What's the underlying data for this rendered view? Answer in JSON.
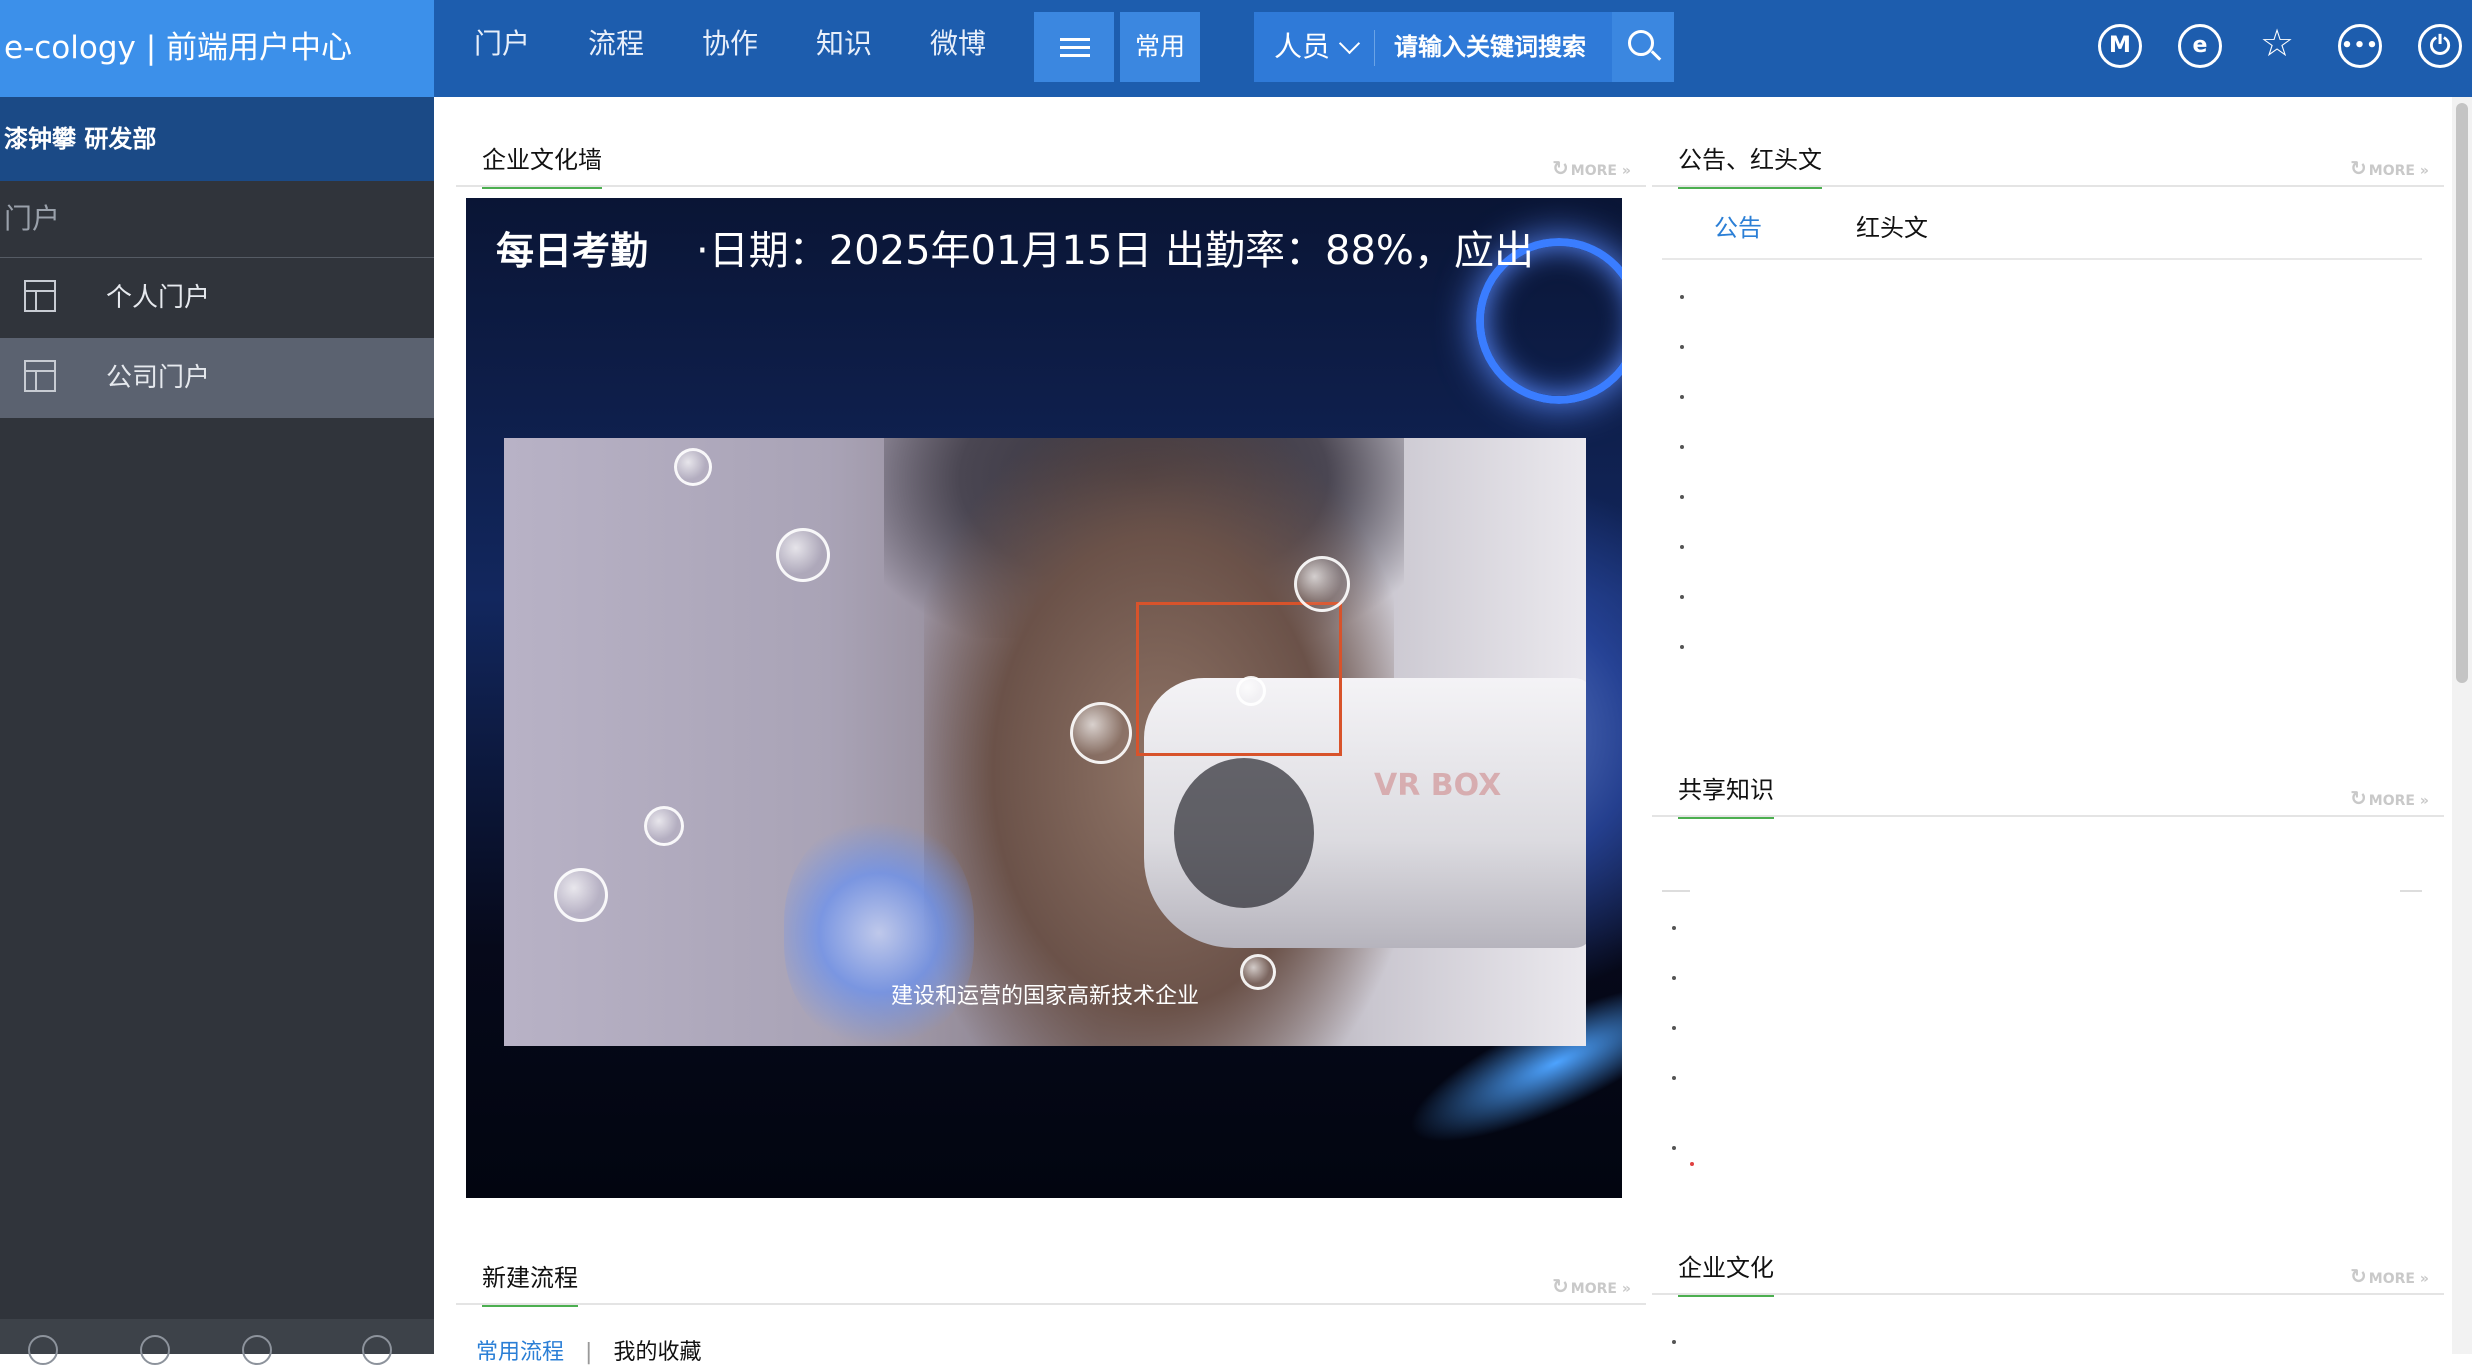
{
  "brand": {
    "title": "e-cology | 前端用户中心"
  },
  "topnav": {
    "items": [
      "门户",
      "流程",
      "协作",
      "知识",
      "微博"
    ],
    "common_label": "常用"
  },
  "search": {
    "scope": "人员",
    "placeholder": "请输入关键词搜索"
  },
  "top_icons": {
    "m_label": "M",
    "e_label": "e"
  },
  "sidebar": {
    "user": "漆钟攀  研发部",
    "section": "门户",
    "items": [
      {
        "label": "个人门户"
      },
      {
        "label": "公司门户"
      }
    ]
  },
  "portlets": {
    "culture_wall": {
      "title": "企业文化墙",
      "ticker_title": "每日考勤",
      "ticker_text": "·日期：2025年01月15日  出勤率：88%，应出",
      "caption": "建设和运营的国家高新技术企业",
      "vr_logo": "VR BOX"
    },
    "notices": {
      "title": "公告、红头文",
      "tabs": [
        "公告",
        "红头文"
      ]
    },
    "knowledge": {
      "title": "共享知识"
    },
    "new_flow": {
      "title": "新建流程",
      "subtabs": [
        "常用流程",
        "我的收藏"
      ],
      "subtab_sep": "|"
    },
    "culture": {
      "title": "企业文化"
    },
    "more_label": "MORE »"
  },
  "colors": {
    "topbar": "#1d5dae",
    "brand_bg": "#3c90ea",
    "sidebar_bg": "#30343b",
    "sidebar_active": "#5b6270",
    "accent_green": "#4caf50",
    "tab_active": "#2b7fd6",
    "focus_box": "#d8532b"
  }
}
